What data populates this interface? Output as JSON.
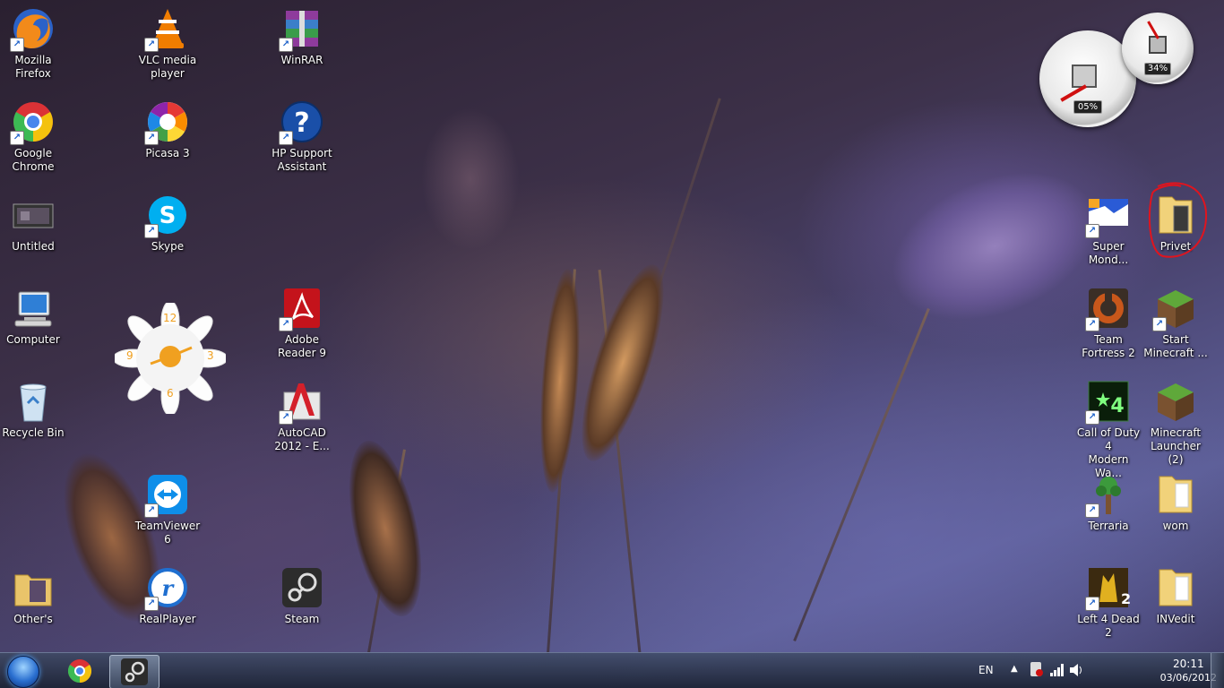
{
  "desktop": {
    "icons": {
      "firefox": "Mozilla\nFirefox",
      "chrome": "Google\nChrome",
      "untitled": "Untitled",
      "computer": "Computer",
      "recycle_bin": "Recycle Bin",
      "others": "Other's",
      "vlc": "VLC media\nplayer",
      "picasa": "Picasa 3",
      "skype": "Skype",
      "teamviewer": "TeamViewer\n6",
      "realplayer": "RealPlayer",
      "winrar": "WinRAR",
      "hp_support": "HP Support\nAssistant",
      "adobe_reader": "Adobe\nReader 9",
      "autocad": "AutoCAD\n2012 - E...",
      "steam": "Steam",
      "super_mond": "Super\nMond...",
      "privet": "Privet",
      "tf2": "Team\nFortress 2",
      "start_minecraft": "Start\nMinecraft ...",
      "cod4": "Call of Duty 4\nModern Wa...",
      "minecraft_launcher": "Minecraft\nLauncher (2)",
      "terraria": "Terraria",
      "wom": "wom",
      "l4d2": "Left 4 Dead 2",
      "invedit": "INVedit"
    },
    "clock_gadget": {
      "n12": "12",
      "n3": "3",
      "n6": "6",
      "n9": "9"
    },
    "meter_gadget": {
      "cpu_percent": "05%",
      "ram_percent": "34%"
    },
    "highlight_color": "#e0141e"
  },
  "taskbar": {
    "language": "EN",
    "time": "20:11",
    "date": "03/06/2012"
  }
}
